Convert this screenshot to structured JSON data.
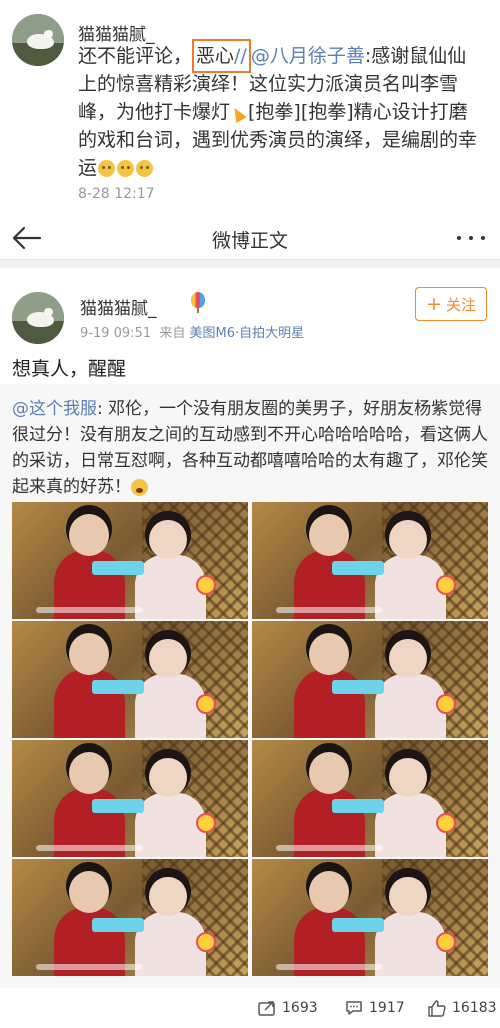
{
  "top_post": {
    "username": "猫猫猫腻_",
    "text_before": "还不能评论，",
    "highlighted": "恶心",
    "text_after_highlight": "//",
    "mention": "@八月徐子善",
    "text_main": ":感谢鼠仙仙上的惊喜精彩演绎！这位实力派演员名叫李雪峰，为他打卡爆灯",
    "text_tail": "[抱拳][抱拳]精心设计打磨的戏和台词，遇到优秀演员的演绎，是编剧的幸运",
    "time": "8-28 12:17"
  },
  "nav": {
    "title": "微博正文",
    "back_icon": "back-arrow-icon",
    "more_icon": "more-dots-icon"
  },
  "post": {
    "username": "猫猫猫腻_",
    "time": "9-19 09:51",
    "from_label": "来自",
    "source": "美图M6·自拍大明星",
    "follow_label": "关注",
    "text": "想真人，醒醒"
  },
  "retweet": {
    "mention": "@这个我服",
    "text": ": 邓伦，一个没有朋友圈的美男子，好朋友杨紫觉得很过分！没有朋友之间的互动感到不开心哈哈哈哈哈，看这俩人的采访，日常互怼啊，各种互动都嘻嘻哈哈的太有趣了，邓伦笑起来真的好苏！"
  },
  "actions": {
    "repost_count": "1693",
    "comment_count": "1917",
    "like_count": "16183"
  },
  "colors": {
    "accent": "#f08c2c",
    "link": "#5b7fb5",
    "highlight_box": "#ef7a2e"
  }
}
